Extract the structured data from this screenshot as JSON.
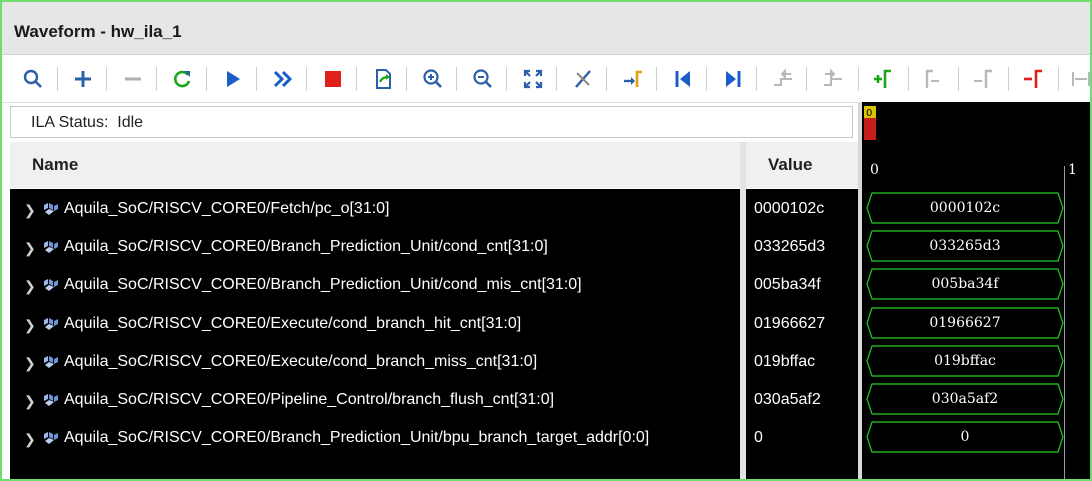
{
  "window": {
    "title": "Waveform - hw_ila_1"
  },
  "toolbar": {
    "icons": [
      "search-icon",
      "add-icon",
      "remove-icon",
      "refresh-icon",
      "run-trigger-icon",
      "run-immediate-icon",
      "stop-icon",
      "export-icon",
      "zoom-in-icon",
      "zoom-out-icon",
      "zoom-fit-icon",
      "cut-marker-icon",
      "go-to-cursor-icon",
      "go-to-start-icon",
      "go-to-end-icon",
      "prev-transition-icon",
      "next-transition-icon",
      "add-marker-icon",
      "prev-marker-icon",
      "next-marker-icon",
      "swap-cursor-icon",
      "snap-icon"
    ]
  },
  "status": {
    "label": "ILA Status:",
    "value": "Idle"
  },
  "columns": {
    "name": "Name",
    "value": "Value"
  },
  "timeline": {
    "start": "0",
    "end": "1",
    "cursor_label": "0"
  },
  "signals": [
    {
      "name": "Aquila_SoC/RISCV_CORE0/Fetch/pc_o[31:0]",
      "value": "0000102c",
      "wave": "0000102c"
    },
    {
      "name": "Aquila_SoC/RISCV_CORE0/Branch_Prediction_Unit/cond_cnt[31:0]",
      "value": "033265d3",
      "wave": "033265d3"
    },
    {
      "name": "Aquila_SoC/RISCV_CORE0/Branch_Prediction_Unit/cond_mis_cnt[31:0]",
      "value": "005ba34f",
      "wave": "005ba34f"
    },
    {
      "name": "Aquila_SoC/RISCV_CORE0/Execute/cond_branch_hit_cnt[31:0]",
      "value": "01966627",
      "wave": "01966627"
    },
    {
      "name": "Aquila_SoC/RISCV_CORE0/Execute/cond_branch_miss_cnt[31:0]",
      "value": "019bffac",
      "wave": "019bffac"
    },
    {
      "name": "Aquila_SoC/RISCV_CORE0/Pipeline_Control/branch_flush_cnt[31:0]",
      "value": "030a5af2",
      "wave": "030a5af2"
    },
    {
      "name": "Aquila_SoC/RISCV_CORE0/Branch_Prediction_Unit/bpu_branch_target_addr[0:0]",
      "value": "0",
      "wave": "0"
    }
  ],
  "colors": {
    "accent_green": "#1aa81a",
    "stop_red": "#e0201a",
    "play_blue": "#1a5cc8",
    "wave_green": "#22cc22",
    "frame_green": "#6fdc6f"
  }
}
